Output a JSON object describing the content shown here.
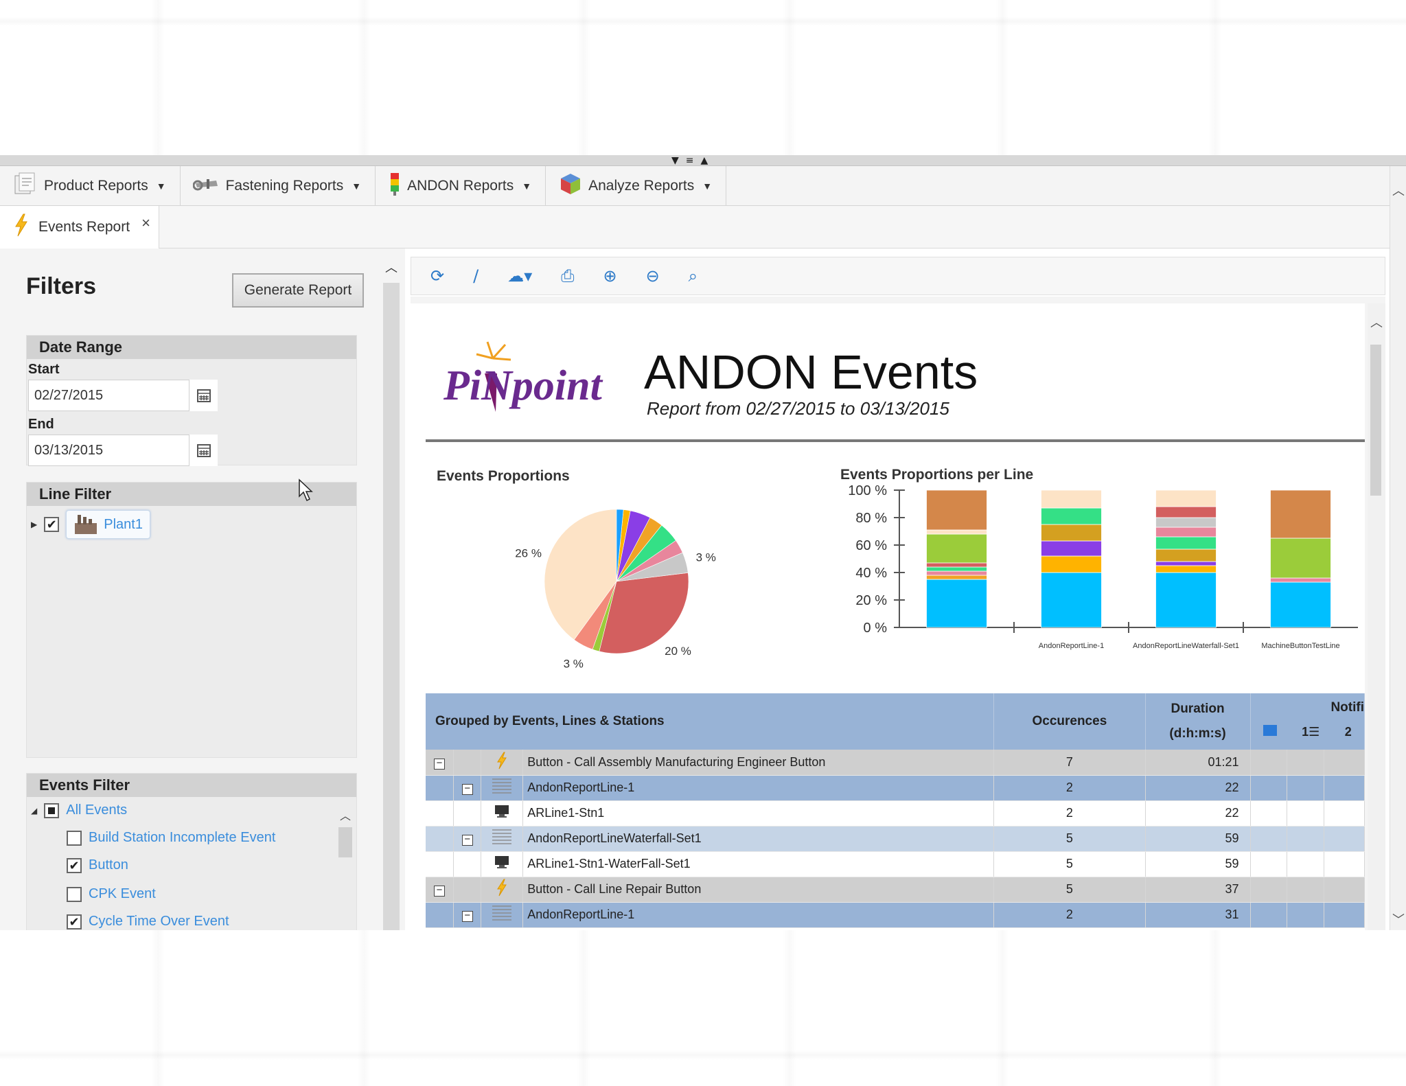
{
  "menubar": {
    "items": [
      {
        "label": "Product Reports",
        "icon": "product-reports-icon"
      },
      {
        "label": "Fastening Reports",
        "icon": "wrench-icon"
      },
      {
        "label": "ANDON Reports",
        "icon": "andon-light-icon"
      },
      {
        "label": "Analyze Reports",
        "icon": "cube-icon"
      }
    ]
  },
  "tab": {
    "label": "Events Report",
    "close": "×"
  },
  "filters": {
    "title": "Filters",
    "generate_button": "Generate Report",
    "date_range": {
      "header": "Date Range",
      "start_label": "Start",
      "start_value": "02/27/2015",
      "end_label": "End",
      "end_value": "03/13/2015"
    },
    "line_filter": {
      "header": "Line Filter",
      "plant": "Plant1"
    },
    "events_filter": {
      "header": "Events Filter",
      "all": "All Events",
      "items": [
        {
          "label": "Build Station Incomplete Event",
          "checked": false
        },
        {
          "label": "Button",
          "checked": true
        },
        {
          "label": "CPK Event",
          "checked": false
        },
        {
          "label": "Cycle Time Over Event",
          "checked": true
        }
      ]
    }
  },
  "report": {
    "logo_text": "PiNpoint",
    "title": "ANDON Events",
    "subtitle": "Report from 02/27/2015 to 03/13/2015"
  },
  "chart_data": [
    {
      "type": "pie",
      "title": "Events Proportions",
      "slices": [
        {
          "value": 26,
          "label": "26 %",
          "color": "#fde3c6"
        },
        {
          "value": 3,
          "label": "3 %",
          "color": "#f28a7a"
        },
        {
          "value": 1,
          "label": "",
          "color": "#9bcc3a"
        },
        {
          "value": 20,
          "label": "20 %",
          "color": "#d35f5f"
        },
        {
          "value": 3,
          "label": "3 %",
          "color": "#c8c8c8"
        },
        {
          "value": 2,
          "label": "",
          "color": "#e8869c"
        },
        {
          "value": 3,
          "label": "",
          "color": "#34e086"
        },
        {
          "value": 2,
          "label": "",
          "color": "#f0a326"
        },
        {
          "value": 3,
          "label": "",
          "color": "#8a3ee6"
        },
        {
          "value": 1,
          "label": "",
          "color": "#ffb300"
        },
        {
          "value": 1,
          "label": "",
          "color": "#1aa0ff"
        }
      ]
    },
    {
      "type": "bar",
      "stacked": true,
      "title": "Events Proportions per Line",
      "ylim": [
        0,
        100
      ],
      "yticks": [
        "0 %",
        "20 %",
        "40 %",
        "60 %",
        "80 %",
        "100 %"
      ],
      "categories": [
        "",
        "AndonReportLine-1",
        "AndonReportLineWaterfall-Set1",
        "MachineButtonTestLine"
      ],
      "stacks": [
        [
          {
            "value": 35,
            "color": "#00bfff"
          },
          {
            "value": 3,
            "color": "#f0a326"
          },
          {
            "value": 3,
            "color": "#e8869c"
          },
          {
            "value": 3,
            "color": "#34e086"
          },
          {
            "value": 3,
            "color": "#d35f5f"
          },
          {
            "value": 21,
            "color": "#9bcc3a"
          },
          {
            "value": 3,
            "color": "#fde3c6"
          },
          {
            "value": 29,
            "color": "#d4874a"
          }
        ],
        [
          {
            "value": 40,
            "color": "#00bfff"
          },
          {
            "value": 12,
            "color": "#ffb300"
          },
          {
            "value": 11,
            "color": "#8a3ee6"
          },
          {
            "value": 12,
            "color": "#d4a020"
          },
          {
            "value": 12,
            "color": "#34e086"
          },
          {
            "value": 13,
            "color": "#fde3c6"
          }
        ],
        [
          {
            "value": 40,
            "color": "#00bfff"
          },
          {
            "value": 5,
            "color": "#ffb300"
          },
          {
            "value": 3,
            "color": "#8a3ee6"
          },
          {
            "value": 9,
            "color": "#d4a020"
          },
          {
            "value": 9,
            "color": "#34e086"
          },
          {
            "value": 7,
            "color": "#e8869c"
          },
          {
            "value": 7,
            "color": "#c8c8c8"
          },
          {
            "value": 8,
            "color": "#d35f5f"
          },
          {
            "value": 12,
            "color": "#fde3c6"
          }
        ],
        [
          {
            "value": 33,
            "color": "#00bfff"
          },
          {
            "value": 3,
            "color": "#e8869c"
          },
          {
            "value": 29,
            "color": "#9bcc3a"
          },
          {
            "value": 35,
            "color": "#d4874a"
          }
        ]
      ]
    }
  ],
  "table": {
    "headers": {
      "group": "Grouped by Events, Lines & Stations",
      "occ": "Occurences",
      "dur1": "Duration",
      "dur2": "(d:h:m:s)",
      "notif": "Notifi"
    },
    "rows": [
      {
        "type": "event",
        "name": "Button - Call Assembly Manufacturing Engineer Button",
        "occ": "7",
        "dur": "01:21"
      },
      {
        "type": "line",
        "name": "AndonReportLine-1",
        "occ": "2",
        "dur": "22"
      },
      {
        "type": "station",
        "name": "ARLine1-Stn1",
        "occ": "2",
        "dur": "22"
      },
      {
        "type": "line2",
        "name": "AndonReportLineWaterfall-Set1",
        "occ": "5",
        "dur": "59"
      },
      {
        "type": "station",
        "name": "ARLine1-Stn1-WaterFall-Set1",
        "occ": "5",
        "dur": "59"
      },
      {
        "type": "event",
        "name": "Button - Call Line Repair Button",
        "occ": "5",
        "dur": "37"
      },
      {
        "type": "line",
        "name": "AndonReportLine-1",
        "occ": "2",
        "dur": "31"
      }
    ]
  }
}
